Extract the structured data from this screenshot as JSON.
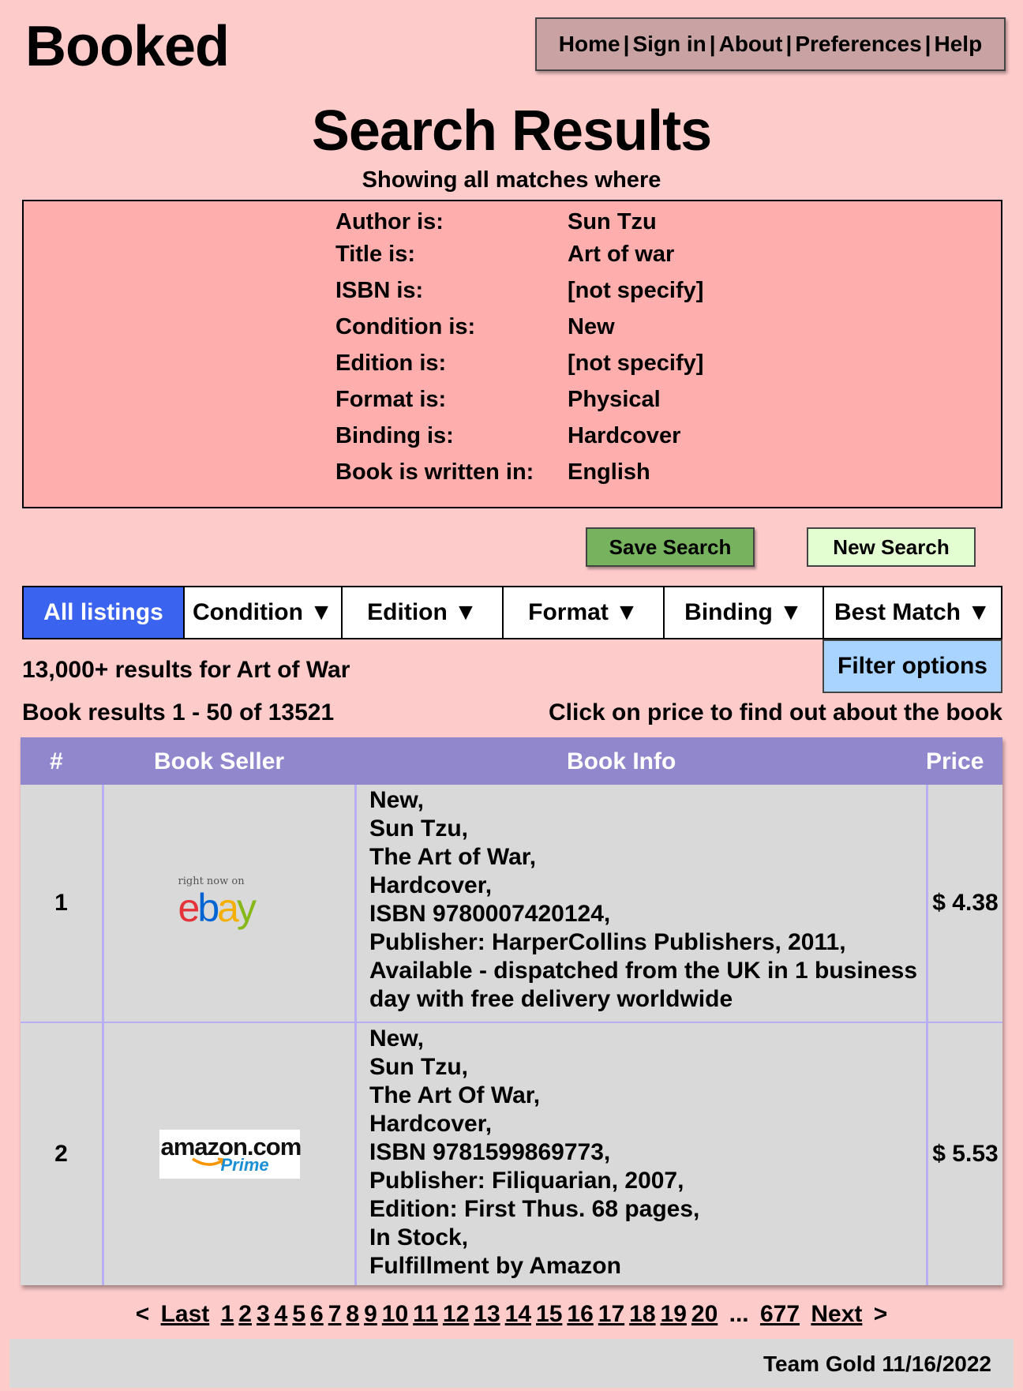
{
  "brand": "Booked",
  "nav": [
    "Home",
    "Sign in",
    "About",
    "Preferences",
    "Help"
  ],
  "page_title": "Search Results",
  "subtitle": "Showing all matches where",
  "criteria": [
    {
      "key": "Author is:",
      "value": "Sun Tzu"
    },
    {
      "key": "Title is:",
      "value": "Art of war"
    },
    {
      "key": "ISBN is:",
      "value": "[not specify]"
    },
    {
      "key": "Condition is:",
      "value": "New"
    },
    {
      "key": "Edition is:",
      "value": "[not specify]"
    },
    {
      "key": "Format is:",
      "value": "Physical"
    },
    {
      "key": "Binding is:",
      "value": "Hardcover"
    },
    {
      "key": "Book is written in:",
      "value": "English"
    }
  ],
  "buttons": {
    "save": "Save Search",
    "new": "New Search"
  },
  "filters": [
    "All listings",
    "Condition ▼",
    "Edition ▼",
    "Format ▼",
    "Binding ▼",
    "Best Match ▼"
  ],
  "filter_options": "Filter options",
  "result_count": "13,000+ results for Art of War",
  "range": "Book results 1 - 50 of 13521",
  "hint": "Click on price to find out about the book",
  "table": {
    "headers": [
      "#",
      "Book Seller",
      "Book Info",
      "Price"
    ],
    "rows": [
      {
        "num": "1",
        "seller": {
          "tag": "right now on",
          "name": "ebay"
        },
        "info": [
          "New,",
          "Sun Tzu,",
          "The Art of War,",
          "Hardcover,",
          "ISBN 9780007420124,",
          "Publisher: HarperCollins Publishers, 2011,",
          "Available - dispatched from the UK in 1 business",
          "day with free delivery worldwide"
        ],
        "price": "$ 4.38"
      },
      {
        "num": "2",
        "seller": {
          "name": "amazon.com",
          "tag": "Prime"
        },
        "info": [
          "New,",
          "Sun Tzu,",
          "The Art Of War,",
          "Hardcover,",
          "ISBN 9781599869773,",
          "Publisher: Filiquarian, 2007,",
          "Edition: First Thus. 68 pages,",
          "In Stock,",
          "Fulfillment by Amazon"
        ],
        "price": "$ 5.53"
      }
    ]
  },
  "pager": {
    "prev": "<",
    "last": "Last",
    "pages": [
      "1",
      "2",
      "3",
      "4",
      "5",
      "6",
      "7",
      "8",
      "9",
      "10",
      "11",
      "12",
      "13",
      "14",
      "15",
      "16",
      "17",
      "18",
      "19",
      "20"
    ],
    "ellipsis": "...",
    "final_page": "677",
    "next": "Next",
    "next_arrow": ">"
  },
  "footer": "Team Gold 11/16/2022",
  "colors": {
    "background": "#fecbcb",
    "criteria_box": "#ffaeae",
    "save_button": "#77b35f",
    "new_button": "#e3ffd2",
    "active_filter": "#3a63f0",
    "filter_options": "#a8d4ff",
    "table_header": "#9187cc",
    "table_row": "#d9d9d9",
    "ebay_e": "#e53238",
    "ebay_b": "#0064d2",
    "ebay_a": "#f5af02",
    "ebay_y": "#86b817"
  }
}
